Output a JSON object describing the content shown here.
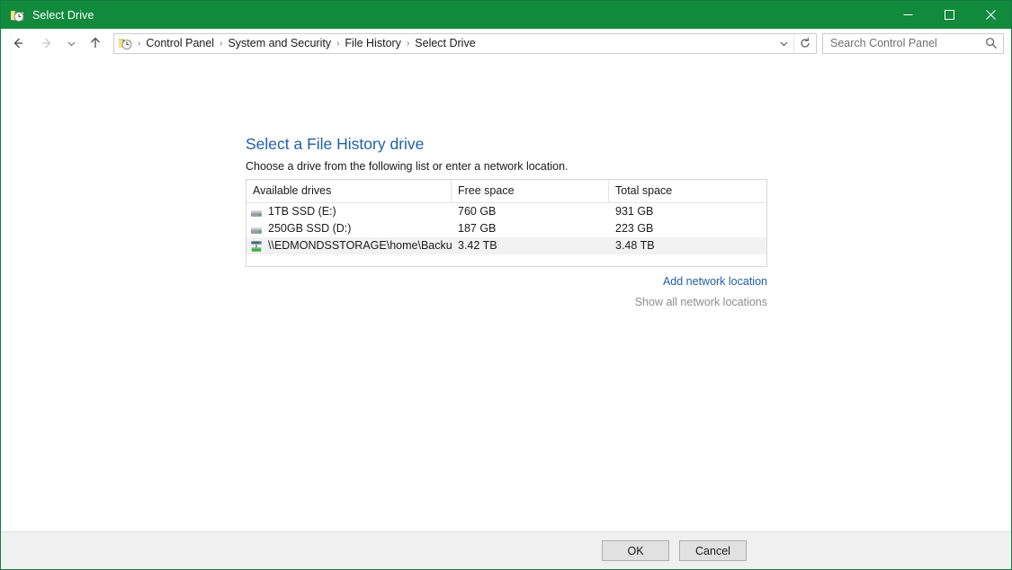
{
  "window": {
    "title": "Select Drive",
    "title_icon": "file-history-folder-icon",
    "accent_color": "#118a3d",
    "controls": {
      "minimize": "minimize-icon",
      "maximize": "maximize-icon",
      "close": "close-icon"
    }
  },
  "navbar": {
    "back": "back-arrow-icon",
    "forward": "forward-arrow-icon",
    "recent": "chevron-down-icon",
    "up": "up-arrow-icon",
    "address_icon": "file-history-folder-icon",
    "breadcrumbs": [
      "Control Panel",
      "System and Security",
      "File History",
      "Select Drive"
    ],
    "separator": "›",
    "dropdown": "chevron-down-icon",
    "refresh": "refresh-icon",
    "search": {
      "placeholder": "Search Control Panel",
      "value": "",
      "icon": "search-icon"
    }
  },
  "main": {
    "title": "Select a File History drive",
    "subtitle": "Choose a drive from the following list or enter a network location.",
    "table": {
      "columns": [
        "Available drives",
        "Free space",
        "Total space"
      ],
      "rows": [
        {
          "icon": "hard-drive-icon",
          "name": "1TB SSD (E:)",
          "free_space": "760 GB",
          "total_space": "931 GB",
          "selected": false
        },
        {
          "icon": "hard-drive-icon",
          "name": "250GB SSD (D:)",
          "free_space": "187 GB",
          "total_space": "223 GB",
          "selected": false
        },
        {
          "icon": "network-drive-icon",
          "name": "\\\\EDMONDSSTORAGE\\home\\Backup",
          "free_space": "3.42 TB",
          "total_space": "3.48 TB",
          "selected": true
        }
      ]
    },
    "links": {
      "add_network_location": "Add network location",
      "show_all_network_locations": "Show all network locations"
    }
  },
  "footer": {
    "ok_label": "OK",
    "cancel_label": "Cancel"
  },
  "colors": {
    "titlebar": "#118a3d",
    "heading": "#1f5fa9",
    "link": "#1f5fa9",
    "link_disabled": "#8d8d8d",
    "selected_row": "#f2f2f2",
    "footer_bg": "#f0f0f0"
  }
}
